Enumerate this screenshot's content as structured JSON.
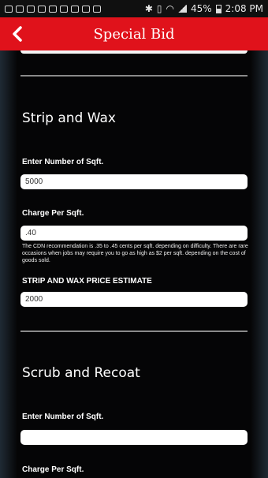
{
  "statusbar": {
    "battery": "45%",
    "time": "2:08 PM"
  },
  "header": {
    "title": "Special Bid"
  },
  "strip_wax": {
    "title": "Strip and Wax",
    "sqft_label": "Enter Number of Sqft.",
    "sqft_value": "5000",
    "charge_label": "Charge Per Sqft.",
    "charge_value": ".40",
    "note": "The CDN recommendation is .35 to .45 cents per sqft. depending on difficulty. There are rare occasions when jobs may require you to go as high as $2 per sqft. depending on the cost of goods sold.",
    "estimate_label": "STRIP AND WAX PRICE ESTIMATE",
    "estimate_value": "2000"
  },
  "scrub_recoat": {
    "title": "Scrub and Recoat",
    "sqft_label": "Enter Number of Sqft.",
    "sqft_value": "",
    "charge_label": "Charge Per Sqft."
  },
  "colors": {
    "accent": "#e0121b"
  },
  "icons": {
    "back": "chevron-left-icon"
  }
}
